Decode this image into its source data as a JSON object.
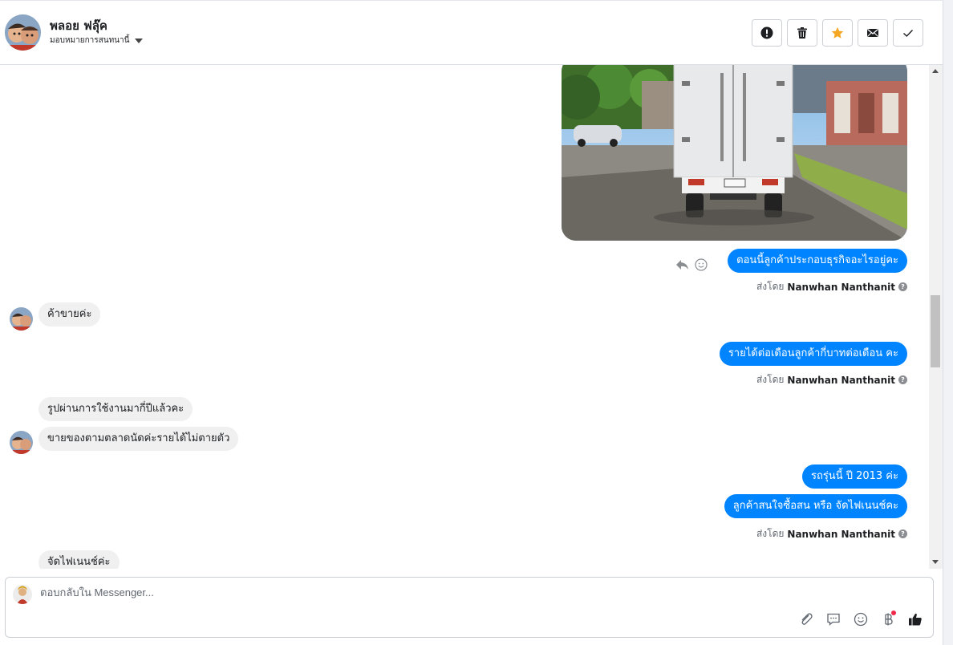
{
  "header": {
    "name": "พลอย ฟลุ๊ค",
    "assign_label": "มอบหมายการสนทนานี้",
    "actions": [
      {
        "name": "report-button",
        "icon": "exclamation-icon"
      },
      {
        "name": "delete-button",
        "icon": "trash-icon"
      },
      {
        "name": "star-button",
        "icon": "star-icon",
        "color": "#f5a623"
      },
      {
        "name": "mark-unread-button",
        "icon": "envelope-icon"
      },
      {
        "name": "mark-done-button",
        "icon": "checkmark-icon"
      }
    ]
  },
  "messages": {
    "m1_out": "ตอนนี้ลูกค้าประกอบธุรกิจอะไรอยู่คะ",
    "m1_sent_prefix": "ส่งโดย",
    "m1_sender": "Nanwhan Nanthanit",
    "m2_in": "ค้าขายค่ะ",
    "m3_out": "รายได้ต่อเดือนลูกค้ากี่บาทต่อเดือน คะ",
    "m3_sent_prefix": "ส่งโดย",
    "m3_sender": "Nanwhan Nanthanit",
    "m4_in": "รูปผ่านการใช้งานมากี่ปีแล้วคะ",
    "m5_in": "ขายของตามตลาดนัดค่ะรายได้ไม่ตายตัว",
    "m6_out": "รถรุ่นนี้ ปี 2013 ค่ะ",
    "m7_out": "ลูกค้าสนใจซื้อสน หรือ จัดไฟเนนช์คะ",
    "m7_sent_prefix": "ส่งโดย",
    "m7_sender": "Nanwhan Nanthanit",
    "m8_in": "จัดไฟเนนช์ค่ะ"
  },
  "composer": {
    "placeholder": "ตอบกลับใน Messenger..."
  },
  "colors": {
    "outgoing_bubble": "#0084ff",
    "incoming_bubble": "#f0f0f0",
    "accent_star": "#f5a623"
  }
}
